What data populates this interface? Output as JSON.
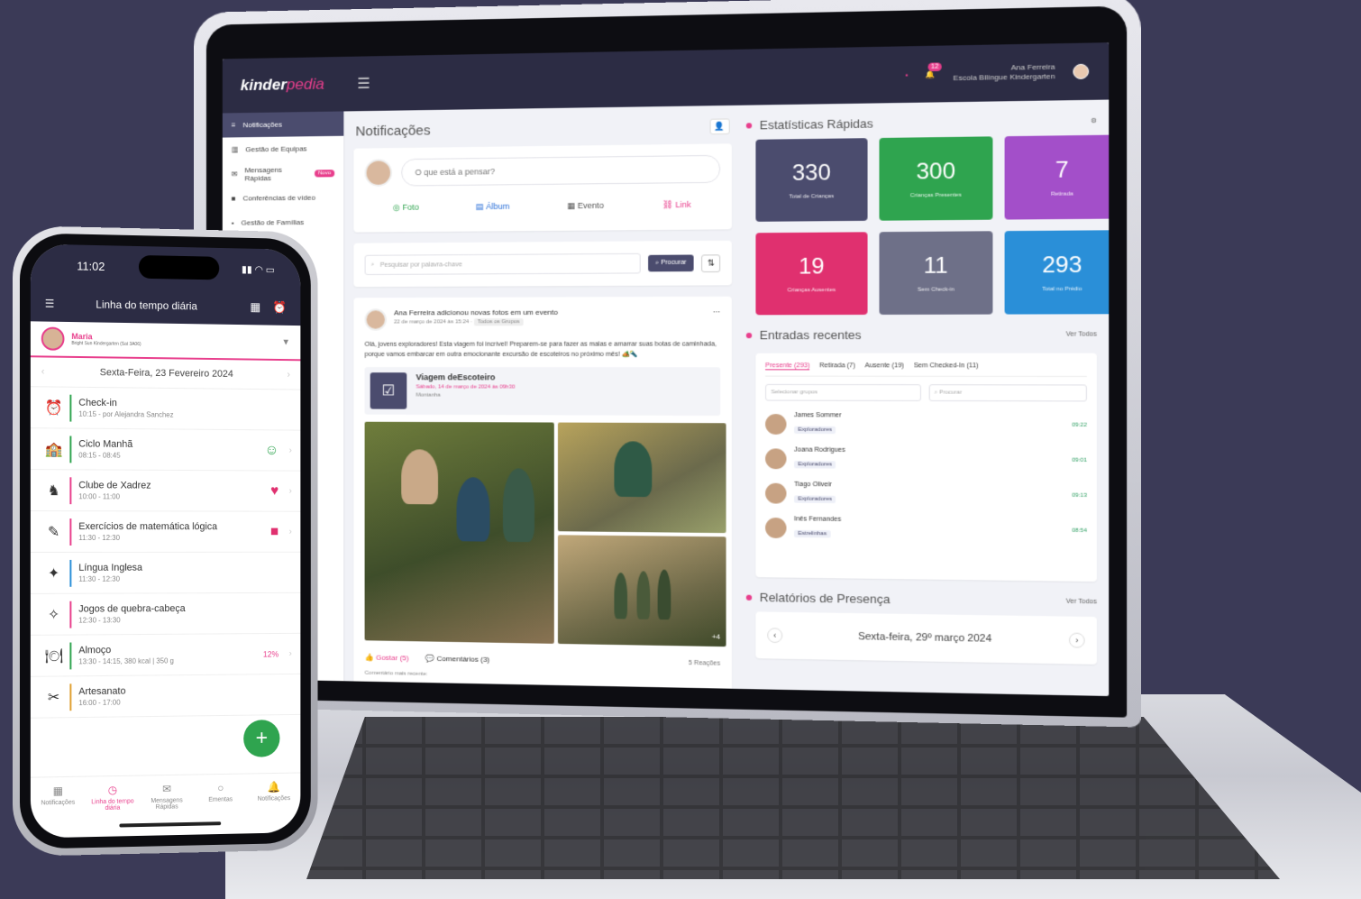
{
  "colors": {
    "brand_pink": "#e83e8c",
    "navy": "#2c2c44",
    "green": "#2fa44f"
  },
  "laptop": {
    "logo": {
      "main": "kinder",
      "accent": "pedia"
    },
    "topbar": {
      "notif_count": "12",
      "user_name": "Ana Ferreira",
      "user_school": "Escola Bilíngue Kindergarten"
    },
    "sidebar": [
      {
        "icon": "≡",
        "label": "Notificações",
        "active": true
      },
      {
        "icon": "▥",
        "label": "Gestão de Equipas"
      },
      {
        "icon": "✉",
        "label": "Mensagens Rápidas",
        "badge": "Novo"
      },
      {
        "icon": "■",
        "label": "Conferências de vídeo"
      },
      {
        "icon": "•",
        "label": "Gestão de Famílias"
      }
    ],
    "feed": {
      "title": "Notificações",
      "composer_placeholder": "O que está a pensar?",
      "actions": [
        "Foto",
        "Álbum",
        "Evento",
        "Link"
      ],
      "search_placeholder": "Pesquisar por palavra-chave",
      "search_button": "Procurar",
      "post": {
        "author_line": "Ana Ferreira adicionou novas fotos em um evento",
        "date": "22 de março de 2024 às 15:24",
        "group": "Todos os Grupos",
        "text": "Olá, jovens exploradores! Esta viagem foi incrível! Preparem-se para fazer as malas e amarrar suas botas de caminhada, porque vamos embarcar em outra emocionante excursão de escoteiros no próximo mês! 🏕️🔦",
        "event_title": "Viagem deEscoteiro",
        "event_date": "Sábado, 14 de março de 2024 às 09h30",
        "event_place": "Montanha",
        "more_photos": "+4",
        "likes": "Gostar (5)",
        "comments": "Comentários (3)",
        "reactions": "5 Reações",
        "recent_comment": "Comentário mais recente:"
      }
    },
    "stats": {
      "title": "Estatísticas Rápidas",
      "items": [
        {
          "value": "330",
          "label": "Total de Crianças",
          "color": "#4b4c6e"
        },
        {
          "value": "300",
          "label": "Crianças Presentes",
          "color": "#2fa44f"
        },
        {
          "value": "7",
          "label": "Retirada",
          "color": "#a34fc9"
        },
        {
          "value": "19",
          "label": "Crianças Ausentes",
          "color": "#e0306f"
        },
        {
          "value": "11",
          "label": "Sem Check-in",
          "color": "#6e7088"
        },
        {
          "value": "293",
          "label": "Total no Prédio",
          "color": "#2a8fd8"
        }
      ]
    },
    "entries": {
      "title": "Entradas recentes",
      "see_all": "Ver Todos",
      "tabs": [
        "Presente (293)",
        "Retirada (7)",
        "Ausente (19)",
        "Sem Checked-In (11)"
      ],
      "group_select": "Selecionar grupos",
      "search_placeholder": "Procurar",
      "rows": [
        {
          "name": "James Sommer",
          "group": "Exploradores",
          "time": "09:22"
        },
        {
          "name": "Joana Rodrigues",
          "group": "Exploradores",
          "time": "09:01"
        },
        {
          "name": "Tiago Oliveir",
          "group": "Exploradores",
          "time": "09:13"
        },
        {
          "name": "Inês Fernandes",
          "group": "Estrelinhas",
          "time": "08:54"
        }
      ]
    },
    "reports": {
      "title": "Relatórios de Presença",
      "see_all": "Ver Todos",
      "date": "Sexta-feira, 29º março 2024"
    }
  },
  "phone": {
    "time": "11:02",
    "title": "Linha do tempo diária",
    "child_name": "Maria",
    "child_school": "Bright Sun Kindergarten (Sat 3A06)",
    "date": "Sexta-Feira, 23 Fevereiro 2024",
    "timeline": [
      {
        "icon": "⏰",
        "title": "Check-in",
        "time": "10:15 - por Alejandra Sanchez",
        "bar": "#2fa44f",
        "end": ""
      },
      {
        "icon": "🏫",
        "title": "Ciclo Manhã",
        "time": "08:15 - 08:45",
        "bar": "#2fa44f",
        "end": "☺"
      },
      {
        "icon": "♞",
        "title": "Clube de Xadrez",
        "time": "10:00 - 11:00",
        "bar": "#e83e8c",
        "end": "♥"
      },
      {
        "icon": "✎",
        "title": "Exercícios de matemática lógica",
        "time": "11:30 - 12:30",
        "bar": "#e83e8c",
        "end": "■"
      },
      {
        "icon": "✦",
        "title": "Língua Inglesa",
        "time": "11:30 - 12:30",
        "bar": "#2a8fd8",
        "end": ""
      },
      {
        "icon": "✧",
        "title": "Jogos de quebra-cabeça",
        "time": "12:30 - 13:30",
        "bar": "#e83e8c",
        "end": ""
      },
      {
        "icon": "🍽",
        "title": "Almoço",
        "time": "13:30 - 14:15, 380 kcal | 350 g",
        "bar": "#2fa44f",
        "end": "12%"
      },
      {
        "icon": "✂",
        "title": "Artesanato",
        "time": "16:00 - 17:00",
        "bar": "#e0a030",
        "end": ""
      }
    ],
    "tabs": [
      {
        "icon": "▦",
        "label": "Notificações"
      },
      {
        "icon": "◷",
        "label": "Linha do tempo diária",
        "active": true
      },
      {
        "icon": "✉",
        "label": "Mensagens Rápidas"
      },
      {
        "icon": "○",
        "label": "Ementas"
      },
      {
        "icon": "🔔",
        "label": "Notificações"
      }
    ]
  }
}
